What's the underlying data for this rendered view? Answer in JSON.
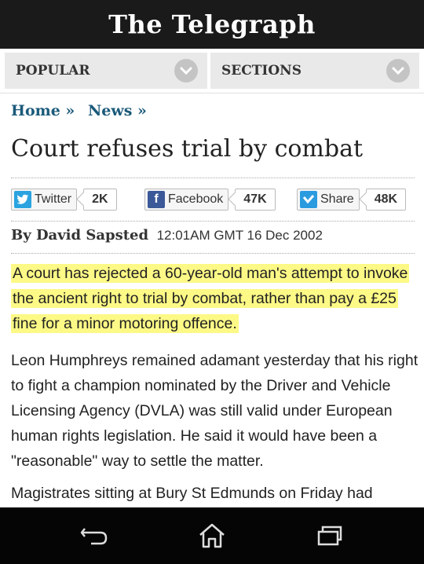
{
  "masthead": {
    "logo_text": "The Telegraph"
  },
  "nav": {
    "popular_label": "POPULAR",
    "sections_label": "SECTIONS"
  },
  "breadcrumb": {
    "home": "Home »",
    "news": "News »"
  },
  "article": {
    "title": "Court refuses trial by combat",
    "author": "By David Sapsted",
    "date": "12:01AM GMT 16 Dec 2002",
    "lead": "A court has rejected a 60-year-old man's attempt to invoke the ancient right to trial by combat, rather than pay a £25 fine for a minor motoring offence.",
    "para2": "Leon Humphreys remained adamant yesterday that his right to fight a champion nominated by the Driver and Vehicle Licensing Agency (DVLA) was still valid under European human rights legislation. He said it would have been a \"reasonable\" way to settle the matter.",
    "para3": "Magistrates sitting at Bury St Edmunds on Friday had"
  },
  "social": {
    "twitter": {
      "label": "Twitter",
      "count": "2K",
      "color": "#2aa3e0"
    },
    "facebook": {
      "label": "Facebook",
      "count": "47K",
      "color": "#3b5998"
    },
    "share": {
      "label": "Share",
      "count": "48K",
      "color": "#2b9be0"
    }
  },
  "colors": {
    "link": "#1b5a7a",
    "highlight": "#fdf986"
  },
  "system_nav": {
    "icons": [
      "back-icon",
      "home-icon",
      "recent-apps-icon"
    ]
  }
}
